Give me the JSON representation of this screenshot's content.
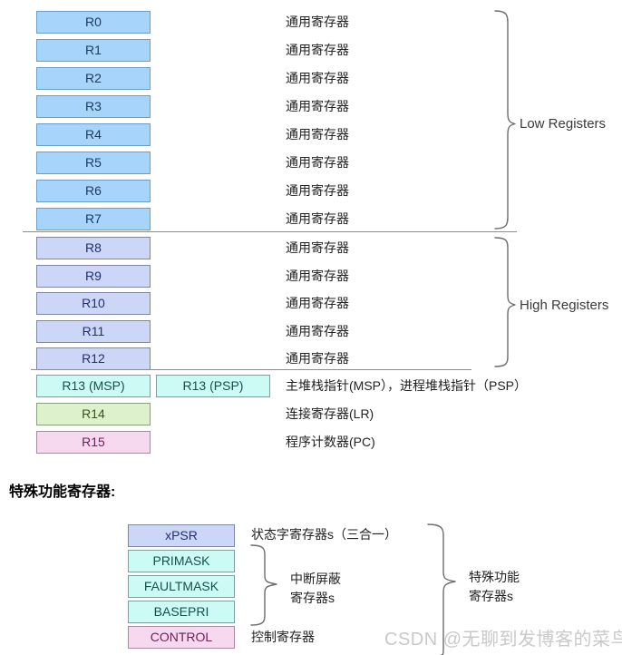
{
  "diagram": {
    "title_special": "特殊功能寄存器:",
    "watermark": "CSDN @无聊到发博客的菜鸟",
    "core_registers": [
      {
        "name": "R0",
        "desc": "通用寄存器",
        "group": "low"
      },
      {
        "name": "R1",
        "desc": "通用寄存器",
        "group": "low"
      },
      {
        "name": "R2",
        "desc": "通用寄存器",
        "group": "low"
      },
      {
        "name": "R3",
        "desc": "通用寄存器",
        "group": "low"
      },
      {
        "name": "R4",
        "desc": "通用寄存器",
        "group": "low"
      },
      {
        "name": "R5",
        "desc": "通用寄存器",
        "group": "low"
      },
      {
        "name": "R6",
        "desc": "通用寄存器",
        "group": "low"
      },
      {
        "name": "R7",
        "desc": "通用寄存器",
        "group": "low"
      },
      {
        "name": "R8",
        "desc": "通用寄存器",
        "group": "high"
      },
      {
        "name": "R9",
        "desc": "通用寄存器",
        "group": "high"
      },
      {
        "name": "R10",
        "desc": "通用寄存器",
        "group": "high"
      },
      {
        "name": "R11",
        "desc": "通用寄存器",
        "group": "high"
      },
      {
        "name": "R12",
        "desc": "通用寄存器",
        "group": "high"
      }
    ],
    "stack_pointers": {
      "msp_label": "R13 (MSP)",
      "psp_label": "R13 (PSP)",
      "desc": "主堆栈指针(MSP），进程堆栈指针（PSP）"
    },
    "link_register": {
      "name": "R14",
      "desc": "连接寄存器(LR)"
    },
    "program_counter": {
      "name": "R15",
      "desc": "程序计数器(PC)"
    },
    "group_labels": {
      "low": "Low Registers",
      "high": "High Registers"
    },
    "special_registers": [
      {
        "name": "xPSR",
        "style": "xpsr"
      },
      {
        "name": "PRIMASK",
        "style": "mask"
      },
      {
        "name": "FAULTMASK",
        "style": "mask"
      },
      {
        "name": "BASEPRI",
        "style": "mask"
      },
      {
        "name": "CONTROL",
        "style": "control"
      }
    ],
    "special_descs": {
      "xpsr": "状态字寄存器s（三合一）",
      "mask_line1": "中断屏蔽",
      "mask_line2": "寄存器s",
      "control": "控制寄存器",
      "outer_line1": "特殊功能",
      "outer_line2": "寄存器s"
    },
    "colors": {
      "low_fill": "#a6d4fa",
      "high_fill": "#ccd6f7",
      "sp_fill": "#ccfbf6",
      "lr_fill": "#ddf2cc",
      "pc_fill": "#f7d9ef",
      "line": "#8d8d8d",
      "watermark": "#c9c9c9"
    }
  }
}
